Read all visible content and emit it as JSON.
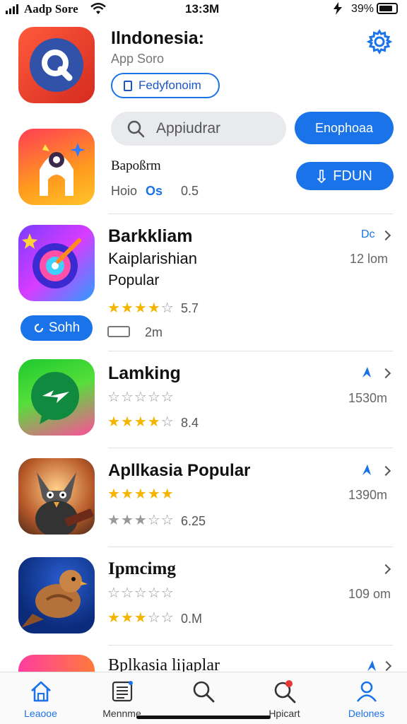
{
  "status_bar": {
    "carrier": "Aadp Sore",
    "time": "13:3M",
    "battery": "39%"
  },
  "header": {
    "title": "Ilndonesia:",
    "subtitle": "App Soro",
    "outline_button": "Fedyfonoim",
    "search_placeholder": "Appiudrar",
    "primary_button": "Enophoaa",
    "second_button": "FDUN"
  },
  "featured": {
    "name": "Bapoßrm",
    "meta_a": "Hoio",
    "meta_b": "Os",
    "meta_c": "0.5"
  },
  "apps": [
    {
      "title": "Barkkliam",
      "subtitle": "Kaiplarishian",
      "category": "Popular",
      "rating_value": "5.7",
      "rating_stars": 3.5,
      "badge": "Sohh",
      "extra_label": "2m",
      "size": "12 lom",
      "action_text": "Dc"
    },
    {
      "title": "Lamking",
      "rating_value": "8.4",
      "rating_stars": 3.5,
      "size": "1530m"
    },
    {
      "title": "Apllkasia Popular",
      "rating_value": "6.25",
      "rating_stars": 3,
      "size": "1390m"
    },
    {
      "title": "Ipmcimg",
      "rating_value": "0.M",
      "rating_stars": 3,
      "size": "109 om"
    },
    {
      "title": "Bplkasia lijaplar"
    }
  ],
  "tabs": [
    {
      "label": "Leaooe",
      "icon": "home-icon"
    },
    {
      "label": "Mennme",
      "icon": "news-icon"
    },
    {
      "label": "",
      "icon": "search-icon"
    },
    {
      "label": "Hpicart",
      "icon": "notification-search-icon"
    },
    {
      "label": "Delones",
      "icon": "profile-icon"
    }
  ],
  "colors": {
    "accent": "#1a73e8",
    "star": "#f5b400"
  }
}
